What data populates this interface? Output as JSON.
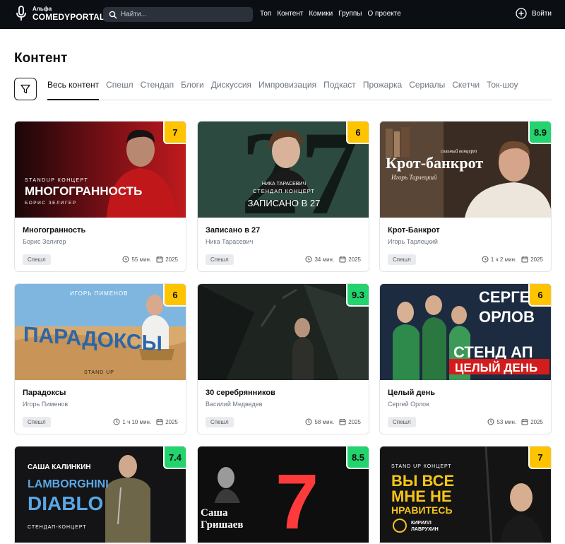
{
  "header": {
    "logo_small": "Альфа",
    "logo_big": "COMEDYPORTAL",
    "search_placeholder": "Найти...",
    "nav": [
      "Топ",
      "Контент",
      "Комики",
      "Группы",
      "О проекте"
    ],
    "login": "Войти"
  },
  "page_title": "Контент",
  "tabs": [
    "Весь контент",
    "Спешл",
    "Стендап",
    "Блоги",
    "Дискуссия",
    "Импровизация",
    "Подкаст",
    "Прожарка",
    "Сериалы",
    "Скетчи",
    "Ток-шоу"
  ],
  "colors": {
    "rating_yellow": "#ffc400",
    "rating_green": "#22d36e",
    "header_bg": "#0b0f14"
  },
  "cards": [
    {
      "title": "Многогранность",
      "author": "Борис Зелигер",
      "badge": "Спешл",
      "duration": "55 мин.",
      "year": "2025",
      "rating": "7",
      "rating_color": "yellow",
      "poster": {
        "lines": [
          "STANDUP КОНЦЕРТ",
          "МНОГОГРАННОСТЬ",
          "БОРИС ЗЕЛИГЕР"
        ]
      }
    },
    {
      "title": "Записано в 27",
      "author": "Ника Тарасевич",
      "badge": "Спешл",
      "duration": "34 мин.",
      "year": "2025",
      "rating": "6",
      "rating_color": "yellow",
      "poster": {
        "lines": [
          "НИКА ТАРАСЕВИЧ",
          "СТЕНДАП КОНЦЕРТ",
          "ЗАПИСАНО В 27"
        ]
      }
    },
    {
      "title": "Крот-Банкрот",
      "author": "Игорь Тарлецкий",
      "badge": "Спешл",
      "duration": "1 ч 2 мин.",
      "year": "2025",
      "rating": "8.9",
      "rating_color": "green",
      "poster": {
        "lines": [
          "сольный концерт",
          "Крот-банкрот",
          "Игорь Тарлецкий"
        ]
      }
    },
    {
      "title": "Парадоксы",
      "author": "Игорь Пименов",
      "badge": "Спешл",
      "duration": "1 ч 10 мин.",
      "year": "2025",
      "rating": "6",
      "rating_color": "yellow",
      "poster": {
        "lines": [
          "ИГОРЬ ПИМЕНОВ",
          "ПАРАДОКСЫ",
          "STAND UP"
        ]
      }
    },
    {
      "title": "30 серебрянников",
      "author": "Василий Медведев",
      "badge": "Спешл",
      "duration": "58 мин.",
      "year": "2025",
      "rating": "9.3",
      "rating_color": "green",
      "poster": {
        "lines": []
      }
    },
    {
      "title": "Целый день",
      "author": "Сергей Орлов",
      "badge": "Спешл",
      "duration": "53 мин.",
      "year": "2025",
      "rating": "6",
      "rating_color": "yellow",
      "poster": {
        "lines": [
          "СЕРГЕЙ",
          "ОРЛОВ",
          "СТЕНД АП",
          "ЦЕЛЫЙ ДЕНЬ"
        ]
      }
    },
    {
      "title": "",
      "author": "",
      "badge": "",
      "duration": "",
      "year": "",
      "rating": "7.4",
      "rating_color": "green",
      "poster": {
        "lines": [
          "САША КАЛИНКИН",
          "LAMBORGHINI",
          "DIABLO",
          "СТЕНДАП-КОНЦЕРТ"
        ]
      }
    },
    {
      "title": "",
      "author": "",
      "badge": "",
      "duration": "",
      "year": "",
      "rating": "8.5",
      "rating_color": "green",
      "poster": {
        "lines": [
          "7",
          "Саша",
          "Гришаев"
        ]
      }
    },
    {
      "title": "",
      "author": "",
      "badge": "",
      "duration": "",
      "year": "",
      "rating": "7",
      "rating_color": "yellow",
      "poster": {
        "lines": [
          "STAND UP КОНЦЕРТ",
          "ВЫ ВСЕ",
          "МНЕ НЕ",
          "НРАВИТЕСЬ",
          "КИРИЛЛ",
          "ЛАВРУХИН"
        ]
      }
    }
  ]
}
